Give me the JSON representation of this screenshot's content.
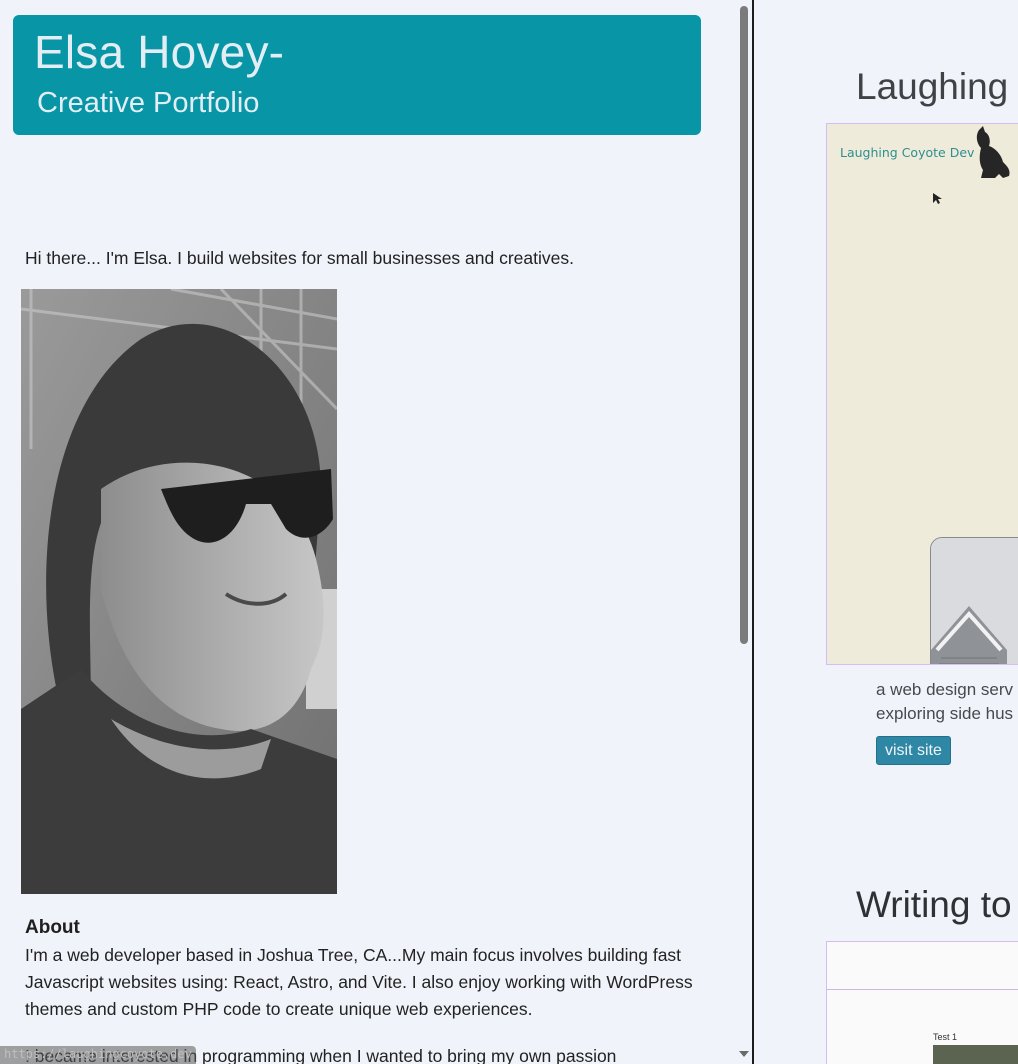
{
  "header": {
    "name": "Elsa Hovey-",
    "tagline": "Creative Portfolio"
  },
  "intro": "Hi there... I'm Elsa. I build websites for small businesses and creatives.",
  "about": {
    "heading": "About",
    "paragraph1": "I'm a web developer based in Joshua Tree, CA...My main focus involves building fast Javascript websites using: React, Astro, and Vite. I also enjoy working with WordPress themes and custom PHP code to create unique web experiences.",
    "paragraph2": "I became interested in programming when I wanted to bring my own passion"
  },
  "status_bar": {
    "url": "https://laughingcoyote.dev"
  },
  "projects": [
    {
      "title": "Laughing C",
      "screenshot_logo_text": "Laughing Coyote Dev",
      "description_line1": "a web design serv",
      "description_line2": "exploring side hus",
      "button_label": "visit site"
    },
    {
      "title": "Writing to",
      "screenshot_label": "Test 1"
    }
  ],
  "colors": {
    "header_bg": "#0895a6",
    "page_bg": "#f0f3f9",
    "button_bg": "#2e87a5",
    "screenshot_border": "#d6bdf0"
  },
  "icons": {
    "coyote": "coyote-howling-icon",
    "cursor": "mouse-pointer-icon",
    "scroll_down": "chevron-down-icon"
  }
}
